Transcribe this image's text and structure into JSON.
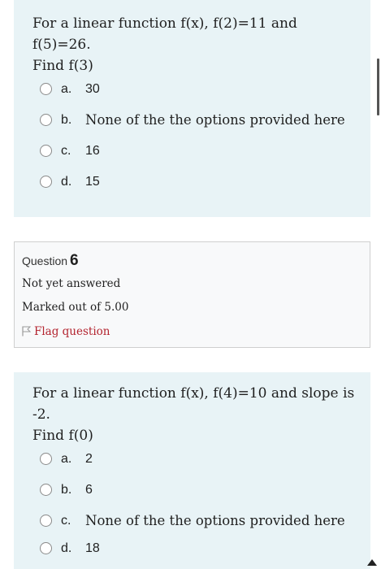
{
  "question5": {
    "line1": "For a linear function f(x), f(2)=11 and f(5)=26.",
    "line2": "Find f(3)",
    "options": [
      {
        "letter": "a.",
        "text": "30"
      },
      {
        "letter": "b.",
        "text": "None of the the options provided here"
      },
      {
        "letter": "c.",
        "text": "16"
      },
      {
        "letter": "d.",
        "text": "15"
      }
    ]
  },
  "question6_info": {
    "label": "Question",
    "number": "6",
    "status": "Not yet answered",
    "marks": "Marked out of 5.00",
    "flag": "Flag question"
  },
  "question6": {
    "line1": "For a linear function f(x), f(4)=10 and slope is -2.",
    "line2": "Find f(0)",
    "options": [
      {
        "letter": "a.",
        "text": "2"
      },
      {
        "letter": "b.",
        "text": "6"
      },
      {
        "letter": "c.",
        "text": "None of the the options provided here"
      },
      {
        "letter": "d.",
        "text": "18"
      }
    ]
  }
}
